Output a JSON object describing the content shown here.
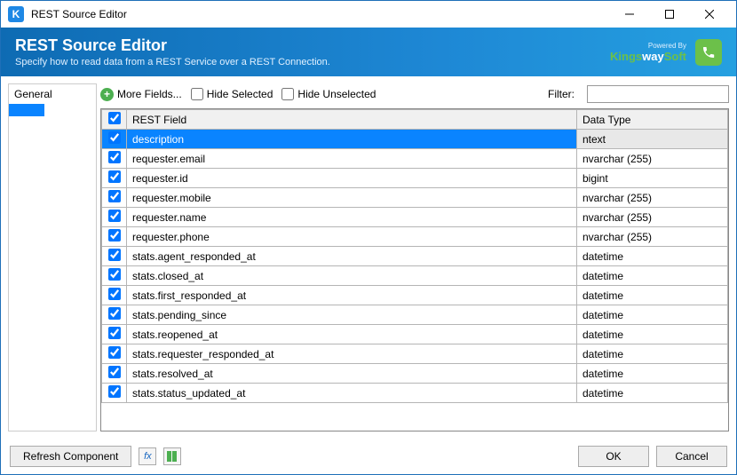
{
  "window": {
    "title": "REST Source Editor",
    "app_icon_letter": "K"
  },
  "header": {
    "title": "REST Source Editor",
    "subtitle": "Specify how to read data from a REST Service over a REST Connection.",
    "brand_powered": "Powered By",
    "brand_name_1": "Kings",
    "brand_name_2": "way",
    "brand_name_3": "Soft"
  },
  "sidebar": {
    "items": [
      {
        "label": "General"
      }
    ]
  },
  "toolbar": {
    "more_fields": "More Fields...",
    "hide_selected": "Hide Selected",
    "hide_unselected": "Hide Unselected",
    "filter_label": "Filter:",
    "filter_value": ""
  },
  "grid": {
    "columns": {
      "check": "",
      "field": "REST Field",
      "dtype": "Data Type"
    },
    "rows": [
      {
        "checked": true,
        "field": "description",
        "dtype": "ntext",
        "selected": true,
        "grey_dtype": true
      },
      {
        "checked": true,
        "field": "requester.email",
        "dtype": "nvarchar (255)",
        "selected": false,
        "grey_dtype": true
      },
      {
        "checked": true,
        "field": "requester.id",
        "dtype": "bigint",
        "selected": false,
        "grey_dtype": true
      },
      {
        "checked": true,
        "field": "requester.mobile",
        "dtype": "nvarchar (255)",
        "selected": false,
        "grey_dtype": true
      },
      {
        "checked": true,
        "field": "requester.name",
        "dtype": "nvarchar (255)",
        "selected": false,
        "grey_dtype": true
      },
      {
        "checked": true,
        "field": "requester.phone",
        "dtype": "nvarchar (255)",
        "selected": false,
        "grey_dtype": true
      },
      {
        "checked": true,
        "field": "stats.agent_responded_at",
        "dtype": "datetime",
        "selected": false,
        "grey_dtype": false
      },
      {
        "checked": true,
        "field": "stats.closed_at",
        "dtype": "datetime",
        "selected": false,
        "grey_dtype": false
      },
      {
        "checked": true,
        "field": "stats.first_responded_at",
        "dtype": "datetime",
        "selected": false,
        "grey_dtype": false
      },
      {
        "checked": true,
        "field": "stats.pending_since",
        "dtype": "datetime",
        "selected": false,
        "grey_dtype": false
      },
      {
        "checked": true,
        "field": "stats.reopened_at",
        "dtype": "datetime",
        "selected": false,
        "grey_dtype": false
      },
      {
        "checked": true,
        "field": "stats.requester_responded_at",
        "dtype": "datetime",
        "selected": false,
        "grey_dtype": false
      },
      {
        "checked": true,
        "field": "stats.resolved_at",
        "dtype": "datetime",
        "selected": false,
        "grey_dtype": false
      },
      {
        "checked": true,
        "field": "stats.status_updated_at",
        "dtype": "datetime",
        "selected": false,
        "grey_dtype": false
      }
    ]
  },
  "footer": {
    "refresh": "Refresh Component",
    "ok": "OK",
    "cancel": "Cancel"
  }
}
